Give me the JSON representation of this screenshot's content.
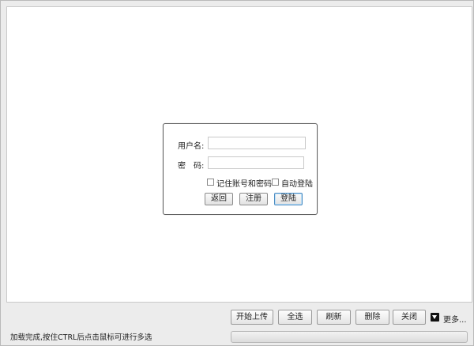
{
  "login": {
    "username_label": "用户名:",
    "username_value": "",
    "password_label": "密　码:",
    "password_value": "",
    "remember_label": "记住账号和密码",
    "remember_checked": false,
    "autologin_label": "自动登陆",
    "autologin_checked": false,
    "back_label": "返回",
    "register_label": "注册",
    "login_label": "登陆"
  },
  "toolbar": {
    "upload_label": "开始上传",
    "select_all_label": "全选",
    "refresh_label": "刷新",
    "delete_label": "删除",
    "close_label": "关闭",
    "more_label": "更多...",
    "more_icon": "dropdown-arrow-icon"
  },
  "status": {
    "text": "加载完成,按住CTRL后点击鼠标可进行多选",
    "progress_percent": 0
  }
}
